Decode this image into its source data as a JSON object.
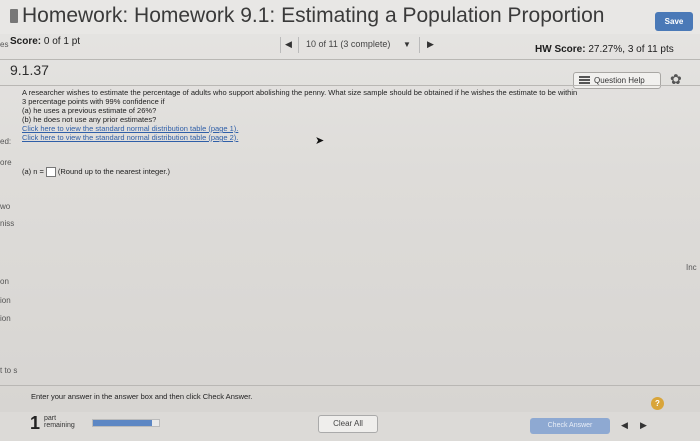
{
  "header": {
    "title": "Homework: Homework 9.1: Estimating a Population Proportion",
    "save_label": "Save"
  },
  "score_row": {
    "score_label": "Score:",
    "score_value": "0 of 1 pt",
    "nav_text": "10 of 11 (3 complete)",
    "hw_score_label": "HW Score:",
    "hw_score_value": "27.27%, 3 of 11 pts"
  },
  "question": {
    "number": "9.1.37",
    "help_label": "Question Help",
    "text_line1": "A researcher wishes to estimate the percentage of adults who support abolishing the penny. What size sample should be obtained if he wishes the estimate to be within",
    "text_line2": "3 percentage points with 99% confidence if",
    "part_a": "(a) he uses a previous estimate of 26%?",
    "part_b": "(b) he does not use any prior estimates?",
    "link1": "Click here to view the standard normal distribution table (page 1).",
    "link2": "Click here to view the standard normal distribution table (page 2).",
    "answer_prefix": "(a) n =",
    "answer_value": "",
    "answer_suffix": "(Round up to the nearest integer.)"
  },
  "edge_fragments": {
    "left": [
      "es",
      "ed:",
      "ore",
      "wo",
      "niss",
      "on",
      "ion",
      "ion",
      "t to s"
    ],
    "right": "Inc"
  },
  "footer": {
    "instruction": "Enter your answer in the answer box and then click Check Answer.",
    "parts_remaining_number": "1",
    "parts_label_line1": "part",
    "parts_label_line2": "remaining",
    "progress_fraction": 0.9,
    "clear_label": "Clear All",
    "check_label": "Check Answer",
    "hint_symbol": "?"
  },
  "colors": {
    "save_button": "#4a79b7",
    "link": "#2f5fa8",
    "progress": "#5d87c4",
    "check_button": "#8ea9d2",
    "hint": "#d9a53a"
  },
  "icons": [
    "title-icon",
    "question-help-icon",
    "gear-icon",
    "prev-arrow-icon",
    "dropdown-icon",
    "next-arrow-icon",
    "cursor-icon",
    "hint-icon"
  ]
}
